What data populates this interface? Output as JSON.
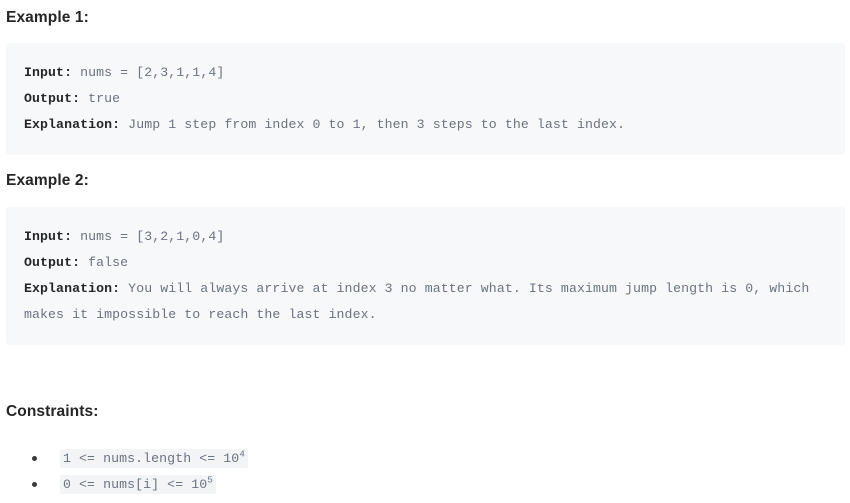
{
  "page": {
    "background": "#ffffff",
    "text_color": "#262626",
    "code_color": "#6b7280",
    "code_block_bg": "#f7f8fa",
    "inline_code_bg": "#f3f4f6"
  },
  "examples": [
    {
      "heading": "Example 1:",
      "lines": [
        {
          "label": "Input:",
          "value": " nums = [2,3,1,1,4]"
        },
        {
          "label": "Output:",
          "value": " true"
        },
        {
          "label": "Explanation:",
          "value": " Jump 1 step from index 0 to 1, then 3 steps to the last index."
        }
      ]
    },
    {
      "heading": "Example 2:",
      "lines": [
        {
          "label": "Input:",
          "value": " nums = [3,2,1,0,4]"
        },
        {
          "label": "Output:",
          "value": " false"
        },
        {
          "label": "Explanation:",
          "value": " You will always arrive at index 3 no matter what. Its maximum jump length is 0, which makes it impossible to reach the last index."
        }
      ]
    }
  ],
  "constraints": {
    "heading": "Constraints:",
    "items": [
      {
        "base": "1 <= nums.length <= 10",
        "exponent": "4"
      },
      {
        "base": "0 <= nums[i] <= 10",
        "exponent": "5"
      }
    ]
  }
}
